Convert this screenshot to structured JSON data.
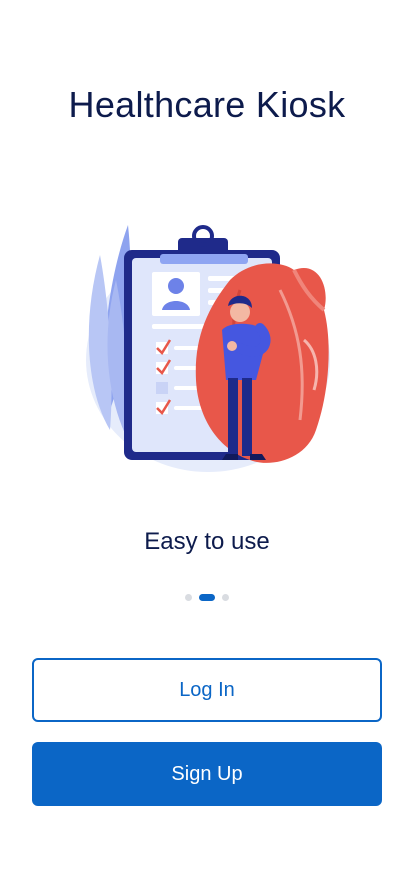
{
  "app": {
    "title": "Healthcare Kiosk"
  },
  "onboarding": {
    "caption": "Easy to use",
    "page_indicator": {
      "total": 3,
      "active_index": 1
    }
  },
  "actions": {
    "login_label": "Log In",
    "signup_label": "Sign Up"
  },
  "colors": {
    "primary": "#0b66c6",
    "title_text": "#0d1b4c",
    "dot_inactive": "#d9dce1"
  },
  "icons": {
    "illustration": "heart-clipboard-doctor-illustration"
  }
}
